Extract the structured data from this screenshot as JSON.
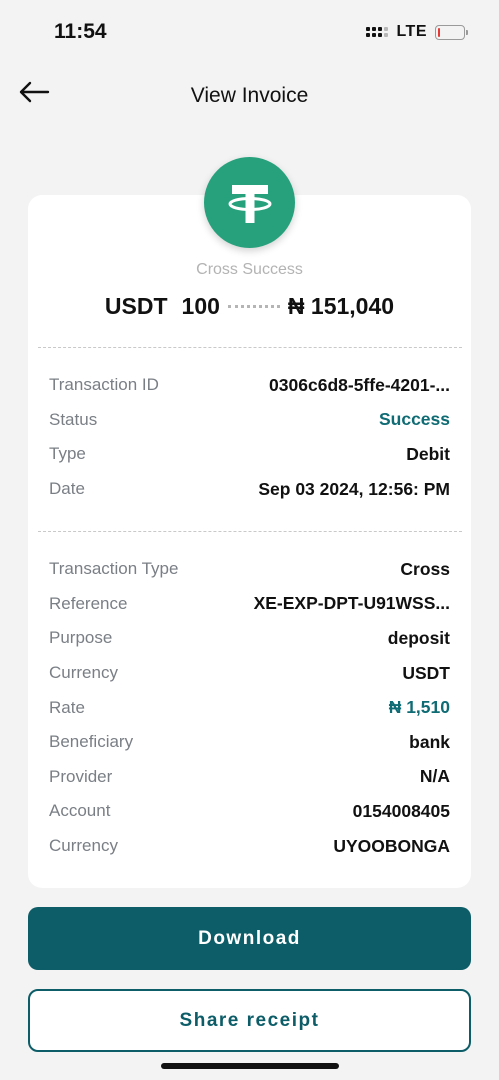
{
  "status_bar": {
    "time": "11:54",
    "network": "LTE",
    "battery_level": 0.1,
    "battery_color": "#e53935"
  },
  "header": {
    "back_icon": "arrow-left-icon",
    "title": "View Invoice"
  },
  "summary": {
    "token_icon": "tether-usdt-icon",
    "token_color": "#26a17b",
    "status_text": "Cross Success",
    "from_currency": "USDT",
    "from_amount": "100",
    "to_amount": "₦ 151,040"
  },
  "details_top": [
    {
      "label": "Transaction ID",
      "value": "0306c6d8-5ffe-4201-...",
      "accent": false
    },
    {
      "label": "Status",
      "value": "Success",
      "accent": true
    },
    {
      "label": "Type",
      "value": "Debit",
      "accent": false
    },
    {
      "label": "Date",
      "value": "Sep 03 2024, 12:56: PM",
      "accent": false
    }
  ],
  "details_bottom": [
    {
      "label": "Transaction Type",
      "value": "Cross",
      "accent": false
    },
    {
      "label": "Reference",
      "value": "XE-EXP-DPT-U91WSS...",
      "accent": false
    },
    {
      "label": "Purpose",
      "value": "deposit",
      "accent": false
    },
    {
      "label": "Currency",
      "value": "USDT",
      "accent": false
    },
    {
      "label": "Rate",
      "value": "₦ 1,510",
      "accent": true
    },
    {
      "label": "Beneficiary",
      "value": "bank",
      "accent": false
    },
    {
      "label": "Provider",
      "value": "N/A",
      "accent": false
    },
    {
      "label": "Account",
      "value": "0154008405",
      "accent": false
    },
    {
      "label": "Currency",
      "value": "UYOOBONGA",
      "accent": false
    }
  ],
  "actions": {
    "download_label": "Download",
    "share_label": "Share receipt"
  },
  "colors": {
    "accent": "#0c5d68",
    "background": "#f3f3f3"
  }
}
